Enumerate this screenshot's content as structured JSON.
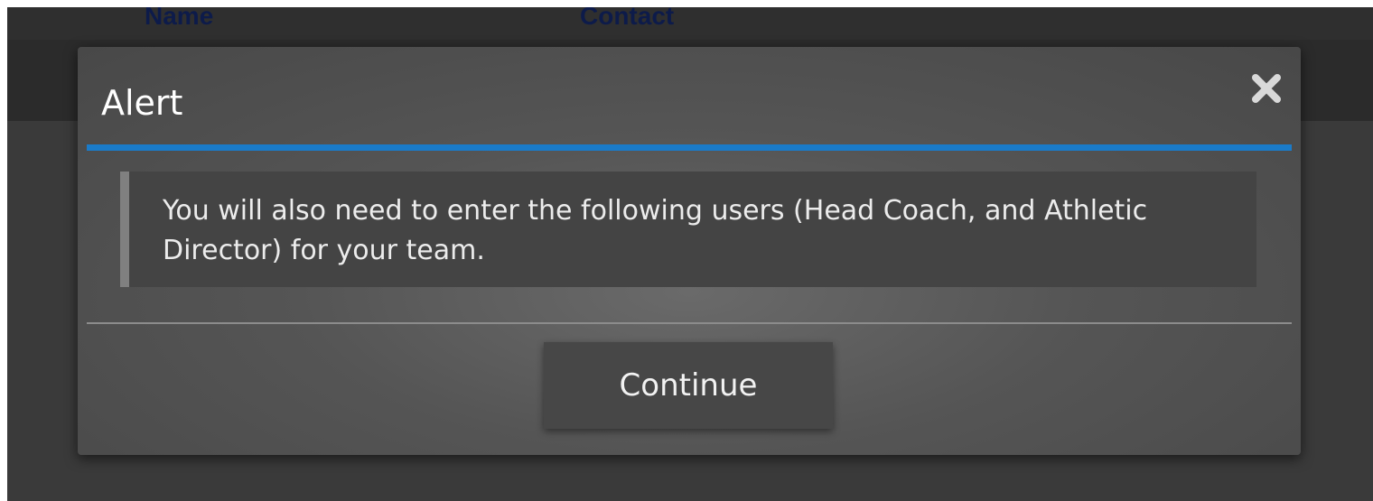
{
  "background_table": {
    "columns": [
      "Name",
      "Contact"
    ]
  },
  "dialog": {
    "title": "Alert",
    "close_icon": "close-icon",
    "message": "You will also need to enter the following users (Head Coach, and Athletic Director) for your team.",
    "continue_label": "Continue"
  },
  "colors": {
    "accent": "#1a7bc9",
    "dialog_bg": "#555555",
    "overlay": "#3a3a3a",
    "column_header_text": "#0d1b4a"
  }
}
